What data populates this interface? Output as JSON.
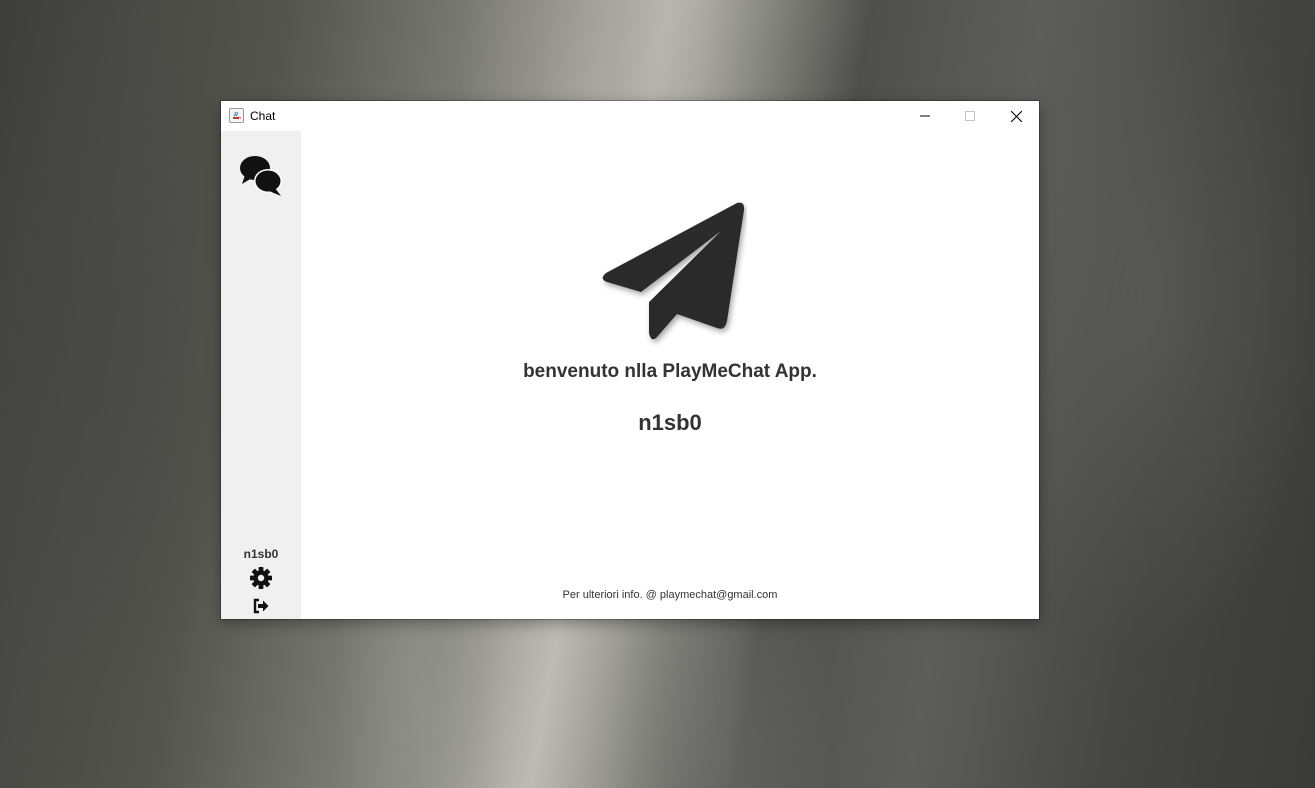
{
  "window": {
    "title": "Chat"
  },
  "sidebar": {
    "username": "n1sb0",
    "icons": [
      "comments-icon",
      "gear-icon",
      "sign-out-icon"
    ]
  },
  "main": {
    "welcome": "benvenuto nlla PlayMeChat App.",
    "username": "n1sb0",
    "footer": "Per ulteriori info. @ playmechat@gmail.com",
    "logo": "paper-plane-icon"
  },
  "colors": {
    "text": "#333333",
    "icon": "#111111",
    "logo": "#2a2a2a",
    "sidebar_bg": "#f0f0f0",
    "window_bg": "#ffffff"
  }
}
